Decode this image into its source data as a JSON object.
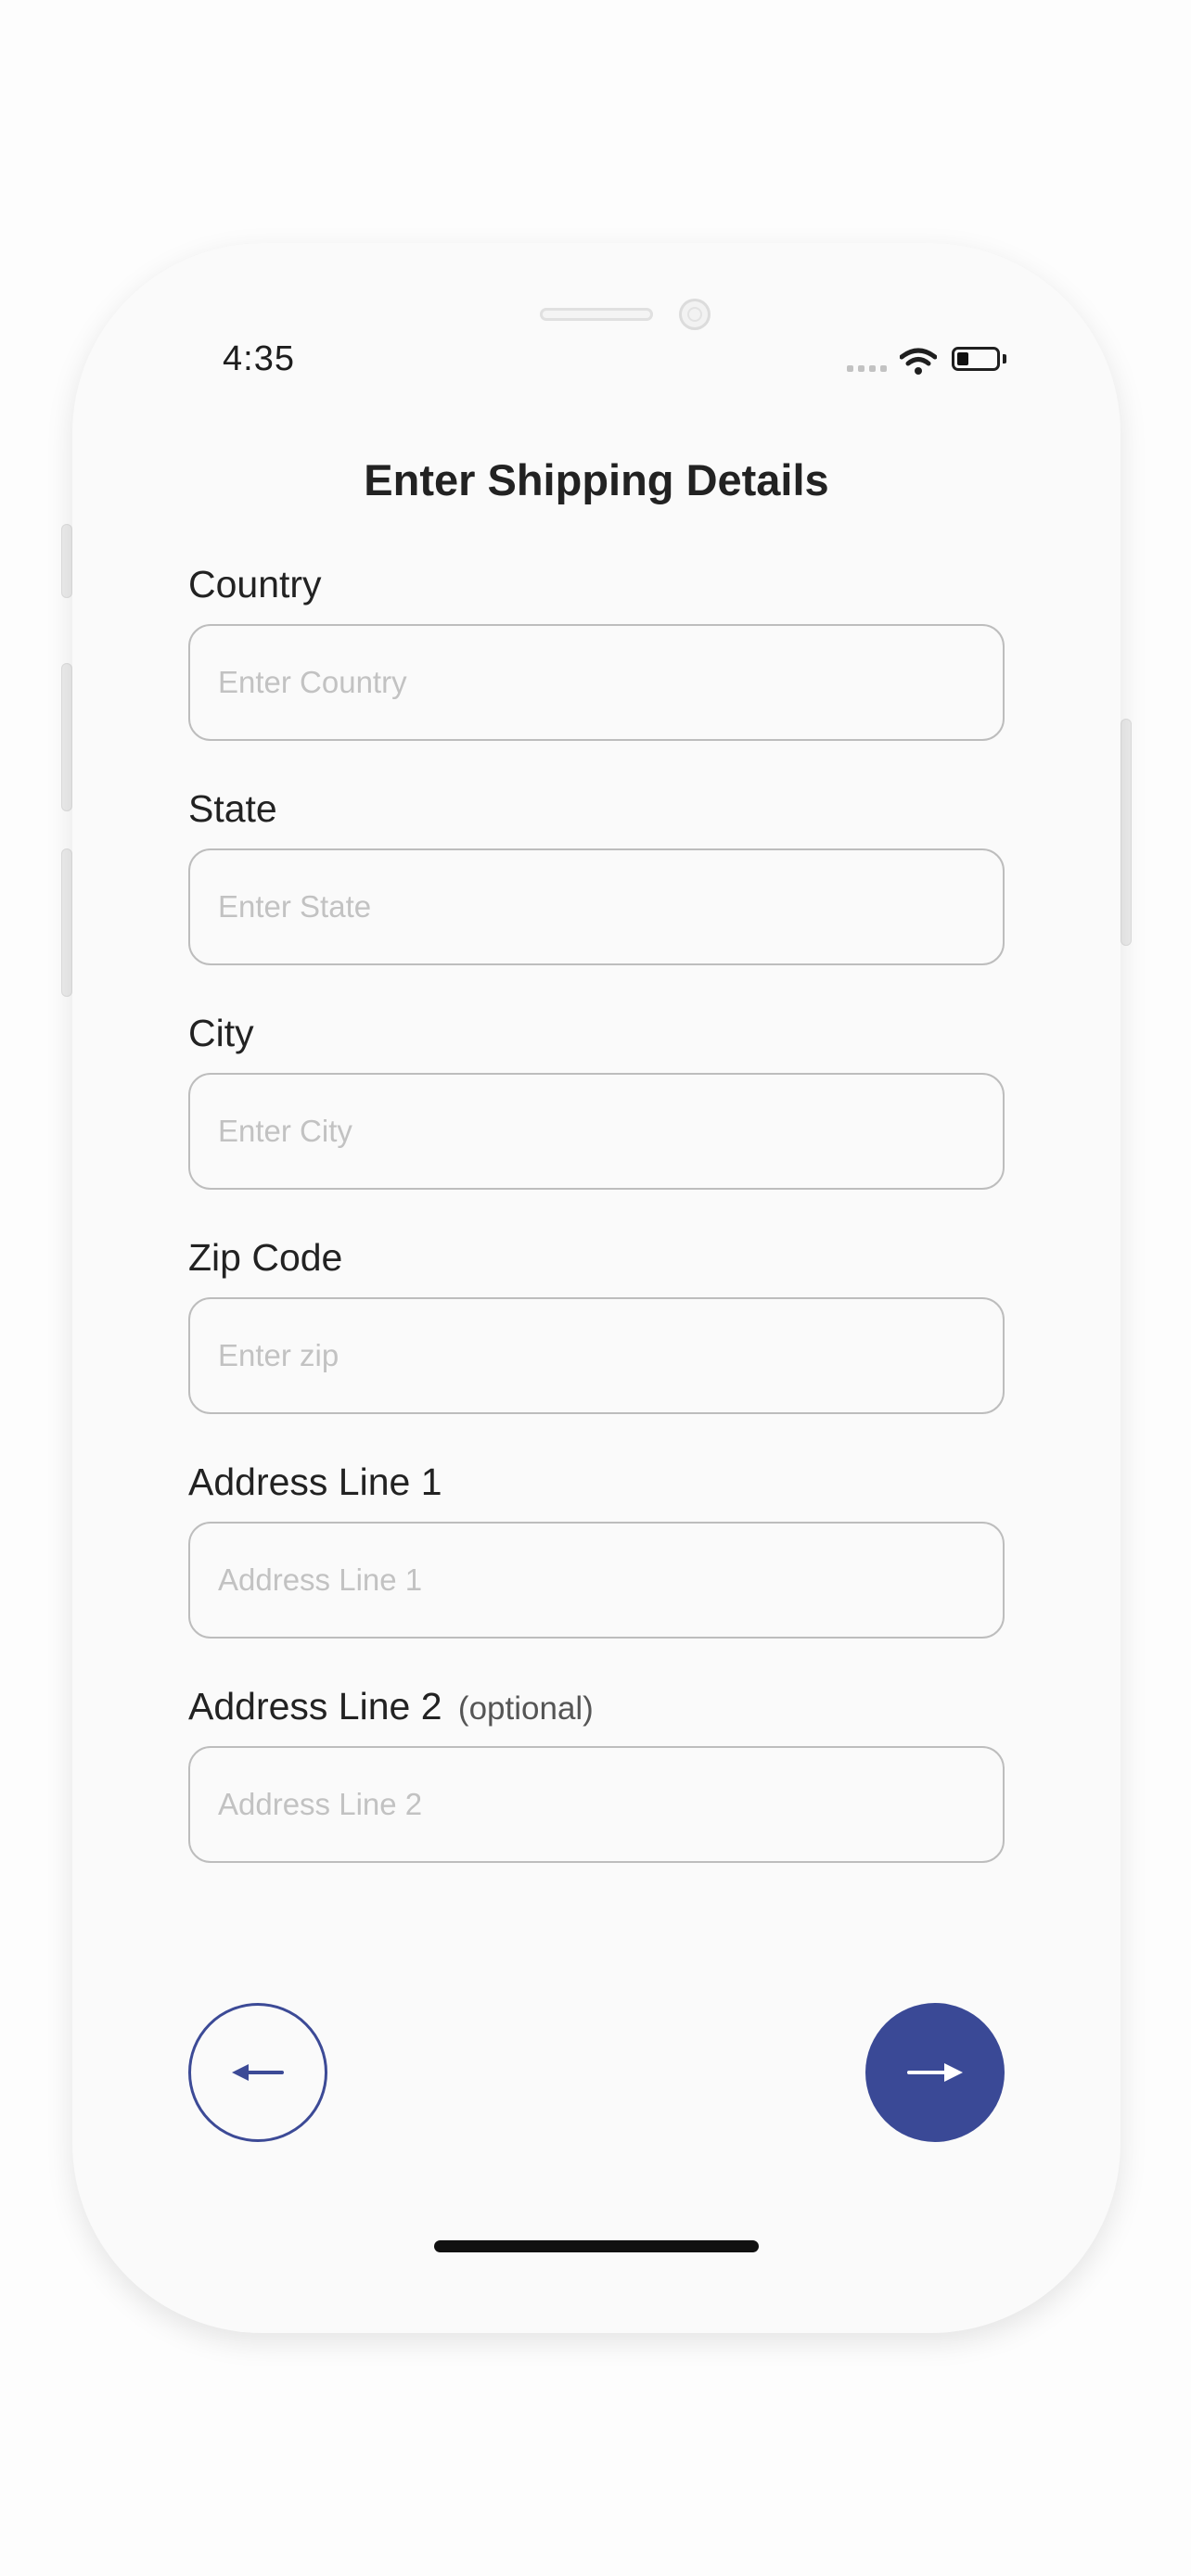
{
  "status_bar": {
    "time": "4:35"
  },
  "form": {
    "title": "Enter Shipping Details",
    "fields": [
      {
        "label": "Country",
        "placeholder": "Enter Country",
        "value": ""
      },
      {
        "label": "State",
        "placeholder": "Enter State",
        "value": ""
      },
      {
        "label": "City",
        "placeholder": "Enter City",
        "value": ""
      },
      {
        "label": "Zip Code",
        "placeholder": "Enter zip",
        "value": ""
      },
      {
        "label": "Address Line 1",
        "placeholder": "Address Line 1",
        "value": ""
      },
      {
        "label": "Address Line 2",
        "optional_note": "(optional)",
        "placeholder": "Address Line 2",
        "value": ""
      }
    ]
  },
  "navigation": {
    "back_icon": "arrow-left-icon",
    "next_icon": "arrow-right-icon"
  },
  "colors": {
    "accent": "#3a4996",
    "input_border": "#bdbdbd",
    "placeholder": "#c2c2c2",
    "text": "#222222"
  }
}
